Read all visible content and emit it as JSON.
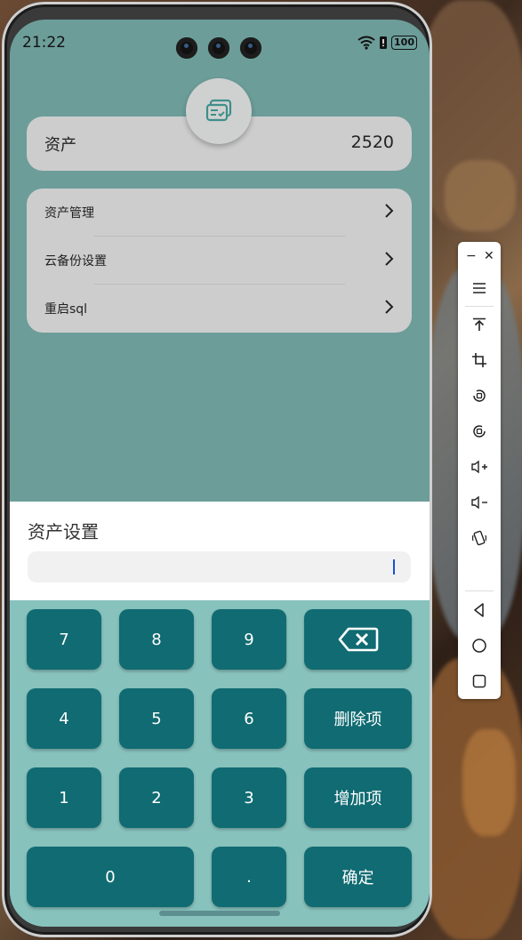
{
  "status_bar": {
    "time": "21:22",
    "battery": "100"
  },
  "assets_card": {
    "label": "资产",
    "value": "2520"
  },
  "menu": [
    {
      "label": "资产管理"
    },
    {
      "label": "云备份设置"
    },
    {
      "label": "重启sql"
    }
  ],
  "dialog": {
    "title": "资产设置",
    "input_value": ""
  },
  "keypad": {
    "k7": "7",
    "k8": "8",
    "k9": "9",
    "k4": "4",
    "k5": "5",
    "k6": "6",
    "k1": "1",
    "k2": "2",
    "k3": "3",
    "k0": "0",
    "dot": ".",
    "delete_item": "删除项",
    "add_item": "增加项",
    "confirm": "确定"
  },
  "toolbar": {
    "icons": [
      "minimize-icon",
      "close-icon",
      "menu-icon",
      "pin-top-icon",
      "crop-icon",
      "rotate-left-icon",
      "rotate-right-icon",
      "volume-up-icon",
      "volume-down-icon",
      "shake-icon",
      "back-icon",
      "home-icon",
      "recents-icon"
    ]
  }
}
